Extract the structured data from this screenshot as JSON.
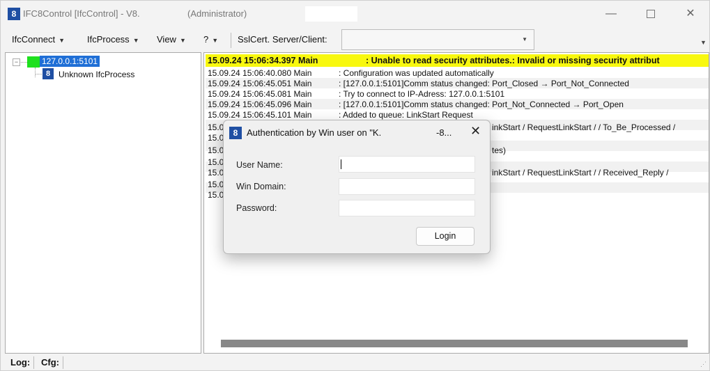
{
  "window": {
    "title": "IFC8Control [IfcControl] - V8.",
    "title_suffix": "(Administrator)",
    "min_label": "—",
    "close_label": "✕"
  },
  "menu": [
    {
      "label": "IfcConnect"
    },
    {
      "label": "IfcProcess"
    },
    {
      "label": "View"
    },
    {
      "label": "?"
    }
  ],
  "ssl": {
    "label": "SslCert. Server/Client:",
    "value": ""
  },
  "tree": {
    "node_label": "127.0.0.1:5101",
    "child_label": "Unknown IfcProcess",
    "status_color": "#1ee01e"
  },
  "log": {
    "warning": {
      "ts": "15.09.24 15:06:34.397 Main",
      "msg": ": Unable to read security attributes.: Invalid or missing security attribut"
    },
    "lines": [
      {
        "ts": "15.09.24 15:06:40.080 Main",
        "msg": ": Configuration was updated automatically"
      },
      {
        "ts": "15.09.24 15:06:45.051 Main",
        "msg": ": [127.0.0.1:5101]Comm status changed: Port_Closed → Port_Not_Connected"
      },
      {
        "ts": "15.09.24 15:06:45.081 Main",
        "msg": ": Try to connect to IP-Adress: 127.0.0.1:5101"
      },
      {
        "ts": "15.09.24 15:06:45.096 Main",
        "msg": ": [127.0.0.1:5101]Comm status changed: Port_Not_Connected → Port_Open"
      },
      {
        "ts": "15.09.24 15:06:45.101 Main",
        "msg": ": Added to queue: LinkStart Request"
      },
      {
        "ts": "15.0",
        "msg": "inkStart / RequestLinkStart /  / To_Be_Processed /"
      },
      {
        "ts": "15.0",
        "msg": ""
      },
      {
        "ts": "15.0",
        "msg": "tes)"
      },
      {
        "ts": "15.0",
        "msg": ""
      },
      {
        "ts": "15.0",
        "msg": "inkStart / RequestLinkStart /  / Received_Reply /"
      },
      {
        "ts": "15.0",
        "msg": ""
      },
      {
        "ts": "15.0",
        "msg": ""
      }
    ]
  },
  "statusbar": {
    "log_tab": "Log:",
    "cfg_tab": "Cfg:"
  },
  "dialog": {
    "title": "Authentication by Win user on \"K.",
    "title_tail": "-8...",
    "close_label": "✕",
    "user_label": "User Name:",
    "domain_label": "Win Domain:",
    "password_label": "Password:",
    "user_value": "",
    "domain_value": "",
    "password_value": "",
    "login_label": "Login"
  },
  "colors": {
    "warning_bg": "#f8f80f",
    "selection": "#1f6fd6",
    "app_icon": "#1f4fa3"
  },
  "icons": {
    "app": "ifc8-icon",
    "process": "ifc8-icon"
  }
}
